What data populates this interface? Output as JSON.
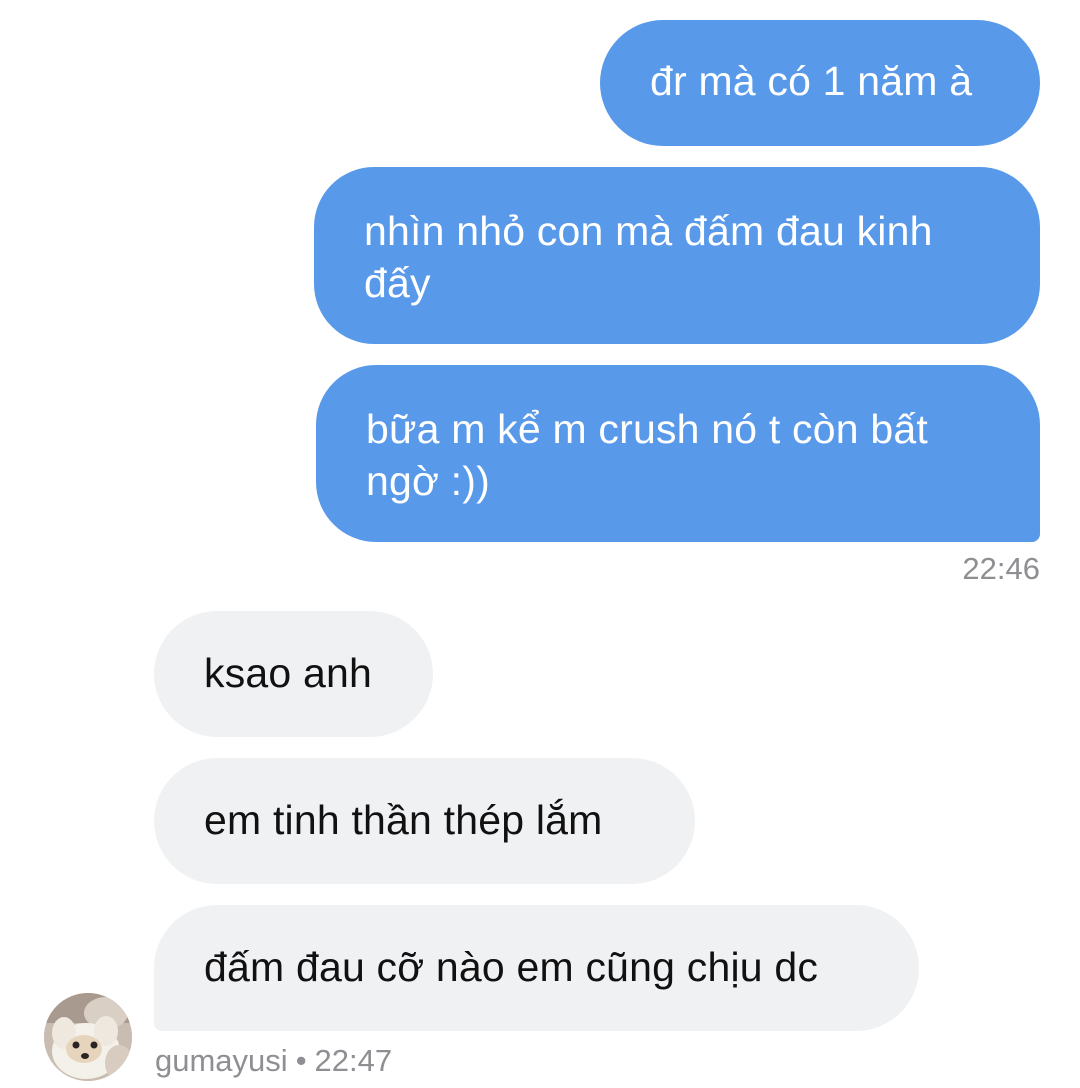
{
  "colors": {
    "sent_bubble": "#5899ea",
    "received_bubble": "#f0f1f3",
    "meta_text": "#8e8e93"
  },
  "sent_messages": [
    {
      "text": "đr mà có 1 năm à"
    },
    {
      "text": "nhìn nhỏ con mà đấm đau kinh đấy"
    },
    {
      "text": "bữa m kể m crush nó t còn bất ngờ :))"
    }
  ],
  "sent_time": "22:46",
  "received_messages": [
    {
      "text": "ksao anh"
    },
    {
      "text": "em tinh thần thép lắm"
    },
    {
      "text": "đấm đau cỡ nào em cũng chịu dc"
    }
  ],
  "sender": {
    "username": "gumayusi",
    "separator": "•",
    "time": "22:47",
    "avatar_icon": "dog-avatar-photo"
  }
}
